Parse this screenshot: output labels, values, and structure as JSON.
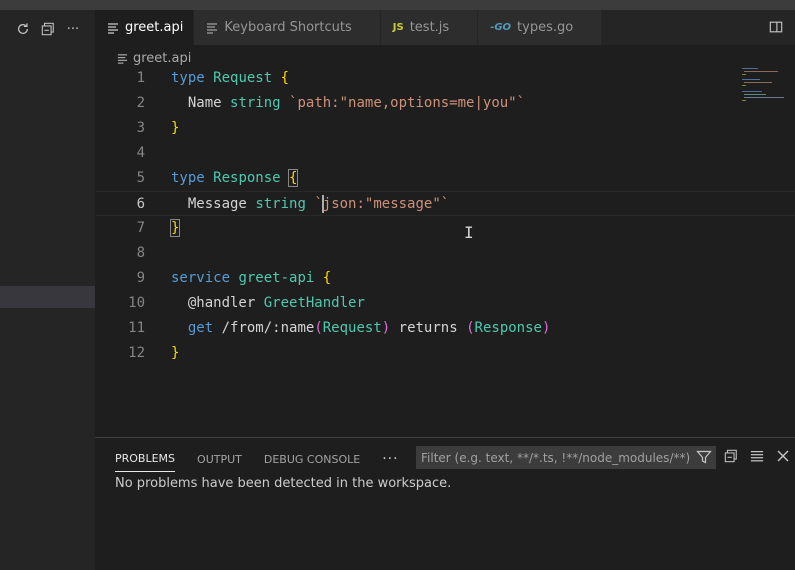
{
  "tabs": [
    {
      "label": "greet.api",
      "icon": "lines-icon",
      "active": true
    },
    {
      "label": "Keyboard Shortcuts",
      "icon": "lines-icon",
      "active": false
    },
    {
      "label": "test.js",
      "icon": "js-icon",
      "active": false
    },
    {
      "label": "types.go",
      "icon": "go-icon",
      "active": false
    }
  ],
  "tab_icons": {
    "js": "JS",
    "go": "-GO"
  },
  "breadcrumb": {
    "file": "greet.api"
  },
  "code": {
    "line_numbers": [
      "1",
      "2",
      "3",
      "4",
      "5",
      "6",
      "7",
      "8",
      "9",
      "10",
      "11",
      "12"
    ],
    "l1": {
      "kw": "type",
      "name": "Request",
      "brace": "{"
    },
    "l2": {
      "field": "Name",
      "type": "string",
      "tag": "`path:\"name,options=me|you\"`"
    },
    "l3": {
      "brace": "}"
    },
    "l5": {
      "kw": "type",
      "name": "Response",
      "brace": "{"
    },
    "l6": {
      "field": "Message",
      "type": "string",
      "tick": "`",
      "tag": "json:\"message\"`"
    },
    "l7": {
      "brace": "}"
    },
    "l9": {
      "kw": "service",
      "name": "greet-api",
      "brace": "{"
    },
    "l10": {
      "at": "@handler",
      "handler": "GreetHandler"
    },
    "l11": {
      "method": "get",
      "path": "/from/:name",
      "open1": "(",
      "req": "Request",
      "close1": ")",
      "returns": "returns",
      "open2": "(",
      "resp": "Response",
      "close2": ")"
    },
    "l12": {
      "brace": "}"
    }
  },
  "panel": {
    "tabs": [
      "PROBLEMS",
      "OUTPUT",
      "DEBUG CONSOLE"
    ],
    "more": "···",
    "filter_placeholder": "Filter (e.g. text, **/*.ts, !**/node_modules/**)",
    "message": "No problems have been detected in the workspace."
  },
  "sidebar": {
    "more": "···"
  },
  "colors": {
    "keyword": "#569cd6",
    "type": "#4ec9b0",
    "string": "#ce9178",
    "bracket": "#ffd700",
    "editor_bg": "#1e1e1e",
    "sidebar_bg": "#252526"
  }
}
